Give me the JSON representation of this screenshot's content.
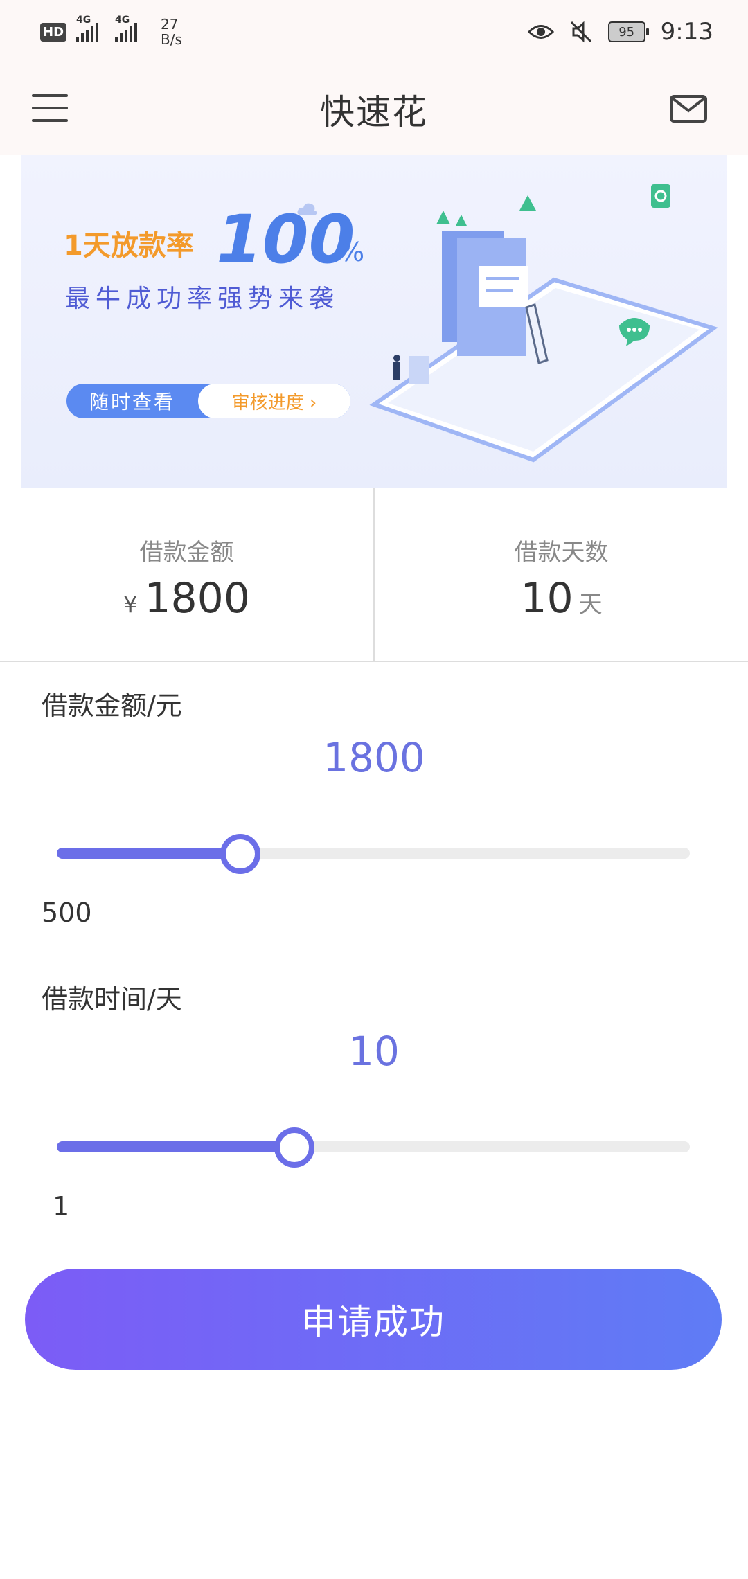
{
  "status": {
    "hd": "HD",
    "net1": "4G",
    "net2": "4G",
    "speed_value": "27",
    "speed_unit": "B/s",
    "battery": "95",
    "time": "9:13"
  },
  "appbar": {
    "title": "快速花",
    "left_icon": "menu-icon",
    "right_icon": "mail-icon"
  },
  "banner": {
    "line1": "1天放款率",
    "big_number": "100",
    "percent": "%",
    "line2": "最牛成功率强势来袭",
    "pill_left": "随时查看",
    "pill_right": "审核进度 ›"
  },
  "summary": {
    "amount_label": "借款金额",
    "currency": "¥",
    "amount_value": "1800",
    "days_label": "借款天数",
    "days_value": "10",
    "days_unit": "天"
  },
  "amount_slider": {
    "label": "借款金额/元",
    "value": "1800",
    "min_label": "500",
    "fraction": 0.29
  },
  "days_slider": {
    "label": "借款时间/天",
    "value": "10",
    "min_label": "1",
    "fraction": 0.375
  },
  "action": {
    "label": "申请成功"
  },
  "colors": {
    "accent": "#6b6ee8",
    "banner_orange": "#f39a2b",
    "banner_blue": "#4c7fe8",
    "button_start": "#7c5cf6",
    "button_end": "#5f7cf5"
  }
}
